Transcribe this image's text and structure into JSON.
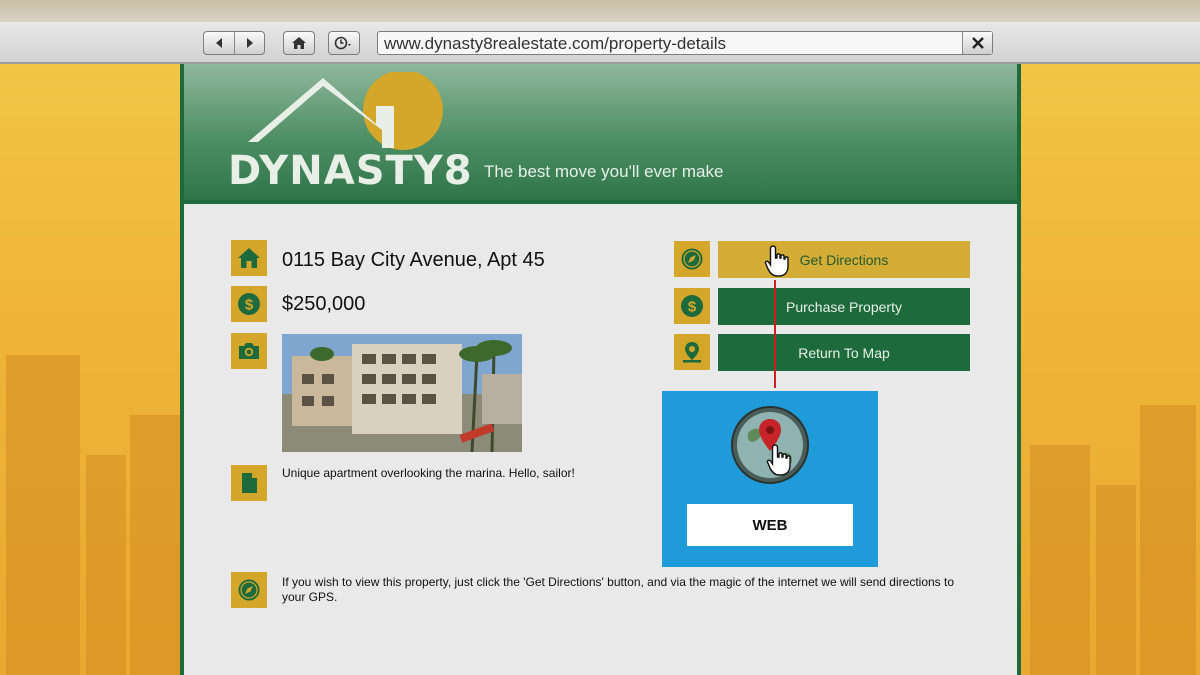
{
  "browser": {
    "url": "www.dynasty8realestate.com/property-details"
  },
  "header": {
    "logo_text": "DYNASTY8",
    "tagline": "The best move you'll ever make"
  },
  "property": {
    "address": "0115 Bay City Avenue, Apt 45",
    "price": "$250,000",
    "description": "Unique apartment overlooking the marina. Hello, sailor!",
    "footer_note": "If you wish to view this property, just click the 'Get Directions' button, and via the magic of the internet we will send directions to your GPS."
  },
  "actions": {
    "get_directions": "Get Directions",
    "purchase": "Purchase Property",
    "return_map": "Return To Map"
  },
  "inset": {
    "label": "WEB"
  },
  "icons": {
    "address": "home-icon",
    "price": "dollar-icon",
    "photo": "camera-icon",
    "description": "document-icon",
    "footer": "compass-icon",
    "get_directions": "compass-icon",
    "purchase": "dollar-icon",
    "return_map": "map-pin-icon"
  },
  "colors": {
    "brand_green": "#1d6b3c",
    "brand_gold": "#d4a62a",
    "inset_blue": "#1e9bd8"
  }
}
